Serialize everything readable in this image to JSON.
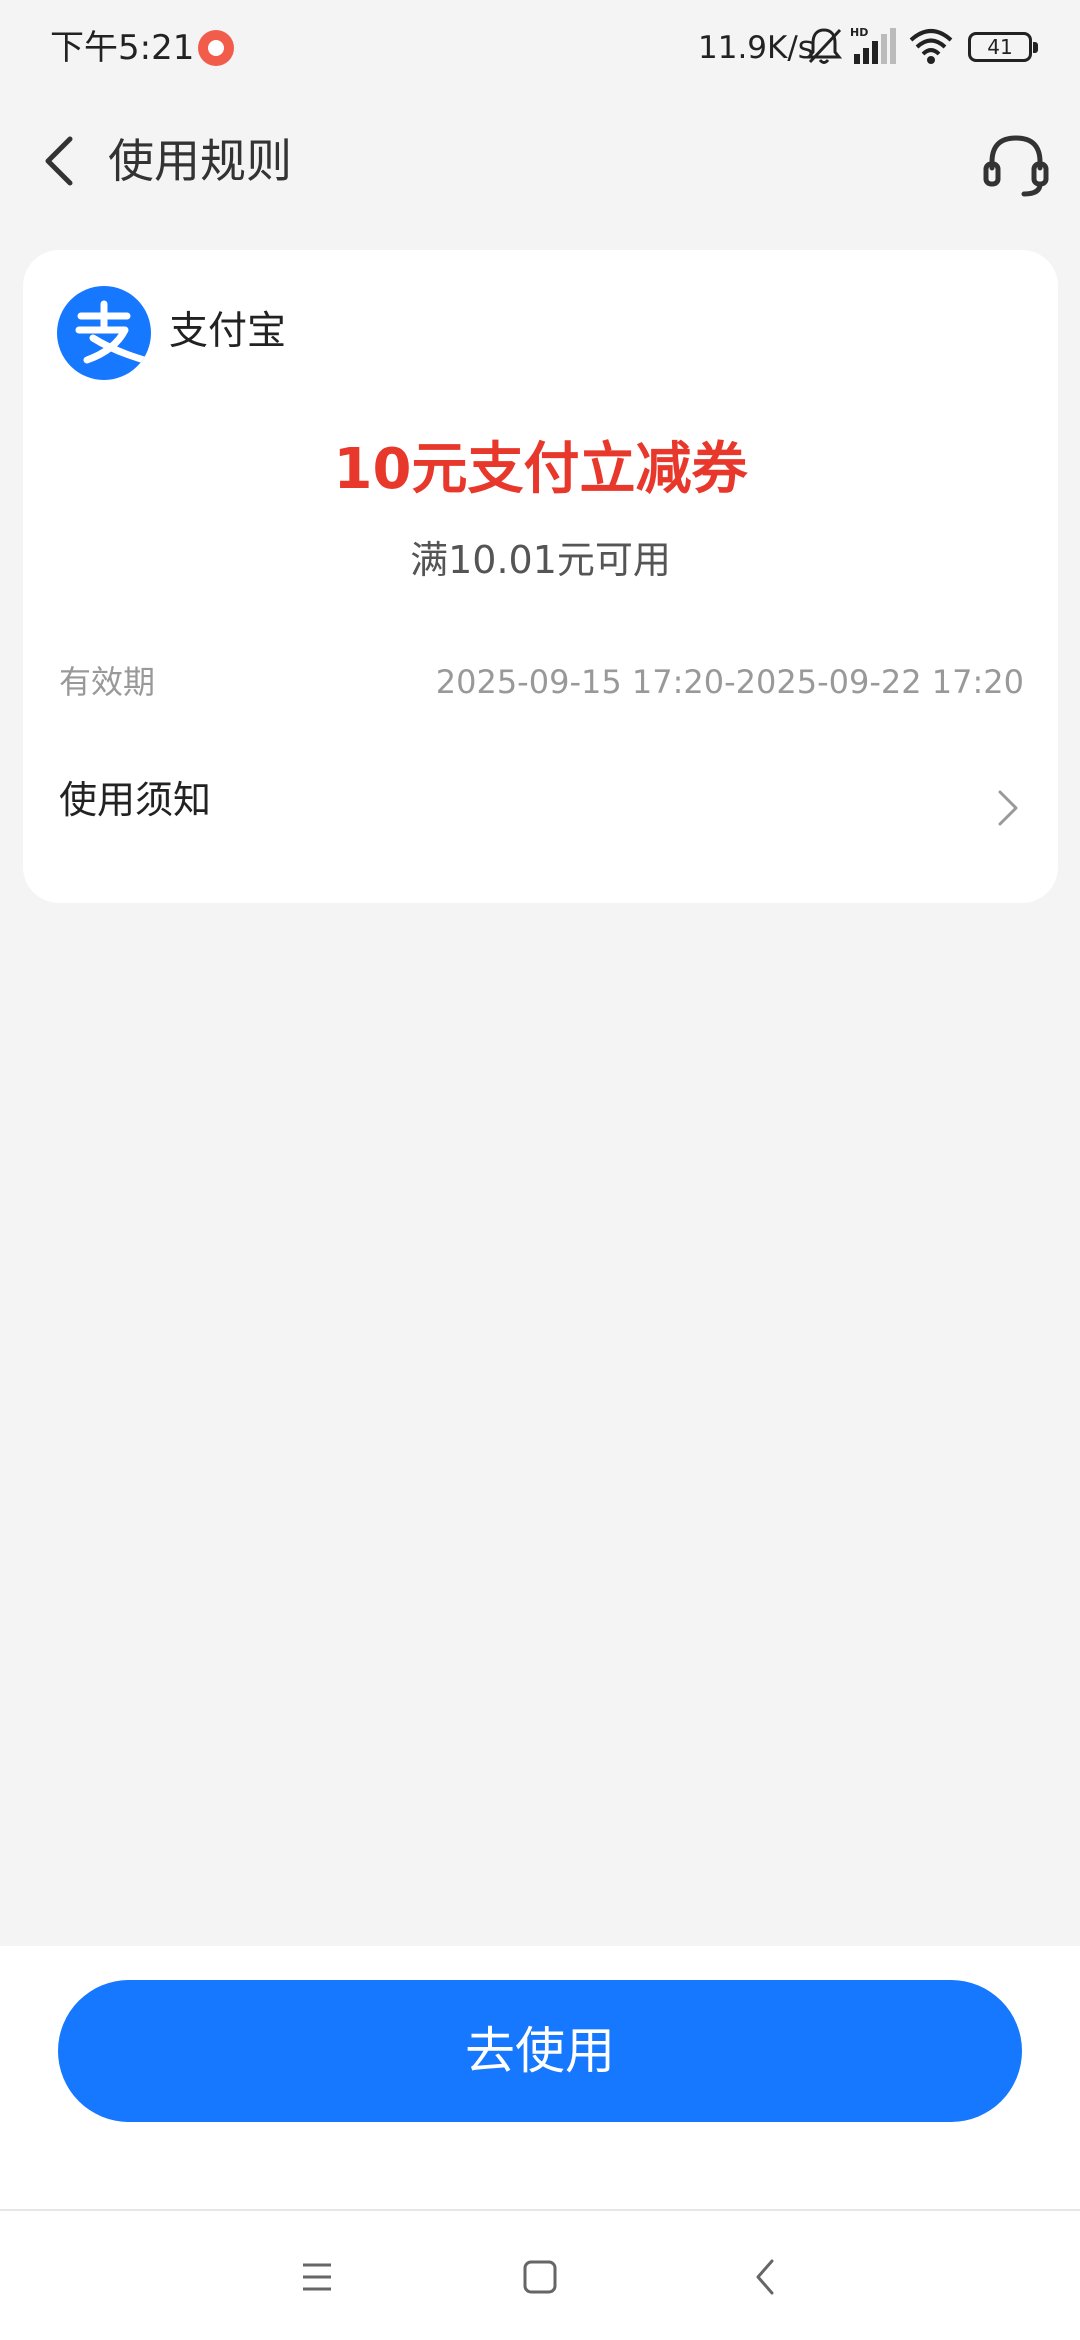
{
  "status_bar": {
    "time": "下午5:21",
    "network_speed": "11.9K/s",
    "battery_level": "41",
    "icons": [
      "music-app-icon",
      "bell-off-icon",
      "hd-signal-icon",
      "wifi-icon",
      "battery-icon"
    ]
  },
  "header": {
    "title": "使用规则",
    "back_icon": "chevron-left-icon",
    "service_icon": "headset-icon"
  },
  "coupon": {
    "brand_name": "支付宝",
    "brand_logo": "alipay-logo",
    "title": "10元支付立减券",
    "condition": "满10.01元可用",
    "validity_label": "有效期",
    "validity_value": "2025-09-15 17:20-2025-09-22 17:20",
    "notice_label": "使用须知"
  },
  "action": {
    "use_button_label": "去使用"
  },
  "nav_bar": {
    "items": [
      "menu-icon",
      "home-square-icon",
      "back-triangle-icon"
    ]
  },
  "colors": {
    "accent_blue": "#1677ff",
    "coupon_red": "#e8382b",
    "background": "#f4f4f4"
  }
}
